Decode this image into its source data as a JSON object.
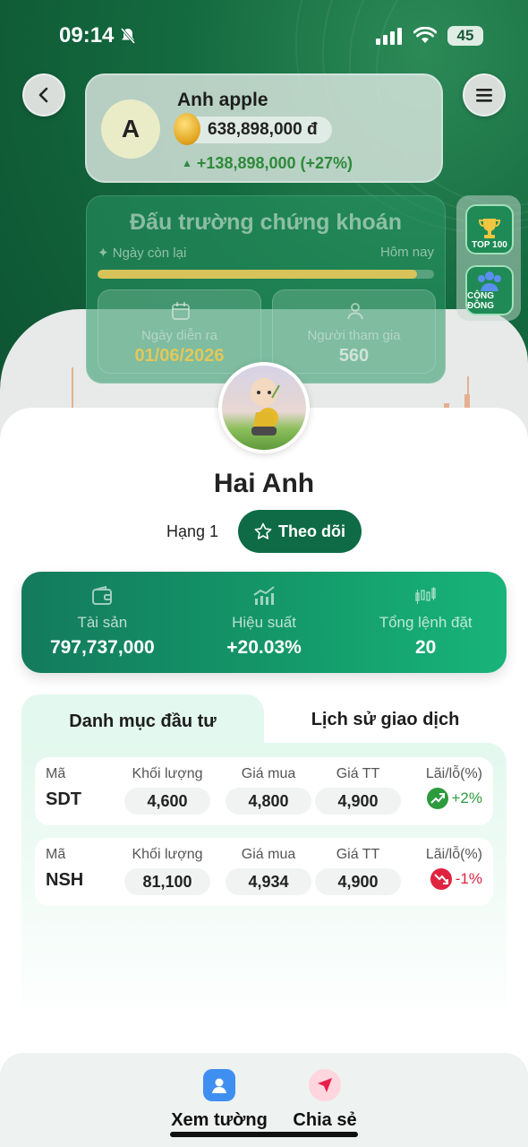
{
  "status_bar": {
    "time": "09:14",
    "battery": "45"
  },
  "user": {
    "avatar_letter": "A",
    "name": "Anh apple",
    "balance": "638,898,000 đ",
    "gain": "+138,898,000 (+27%)"
  },
  "arena": {
    "title": "Đấu trường chứng khoán",
    "days_left_label": "Ngày còn lại",
    "today_label": "Hôm nay",
    "progress_fraction": 0.95,
    "date_label": "Ngày diễn ra",
    "date_value": "01/06/2026",
    "participants_label": "Người tham gia",
    "participants_value": "560",
    "date_color": "#e2c85a"
  },
  "side_widgets": {
    "top100": "TOP 100",
    "community": "CỘNG ĐỒNG"
  },
  "profile": {
    "name": "Hai Anh",
    "rank": "Hạng 1",
    "follow_label": "Theo dõi"
  },
  "stats": [
    {
      "label": "Tài sản",
      "value": "797,737,000",
      "icon": "wallet-icon"
    },
    {
      "label": "Hiệu suất",
      "value": "+20.03%",
      "icon": "growth-chart-icon"
    },
    {
      "label": "Tổng lệnh đặt",
      "value": "20",
      "icon": "candlestick-icon"
    }
  ],
  "tabs": {
    "portfolio": "Danh mục đầu tư",
    "history": "Lịch sử giao dịch"
  },
  "table_headers": {
    "code": "Mã",
    "volume": "Khối lượng",
    "buy_price": "Giá mua",
    "market_price": "Giá TT",
    "pl": "Lãi/lỗ(%)"
  },
  "holdings": [
    {
      "code": "SDT",
      "volume": "4,600",
      "buy_price": "4,800",
      "market_price": "4,900",
      "pl": "+2%",
      "trend": "up"
    },
    {
      "code": "NSH",
      "volume": "81,100",
      "buy_price": "4,934",
      "market_price": "4,900",
      "pl": "-1%",
      "trend": "down"
    }
  ],
  "colors": {
    "up": "#2e9a3e",
    "down": "#e0243f",
    "primary": "#0e6b45"
  },
  "bottom_nav": {
    "wall": "Xem tường",
    "share": "Chia sẻ"
  }
}
